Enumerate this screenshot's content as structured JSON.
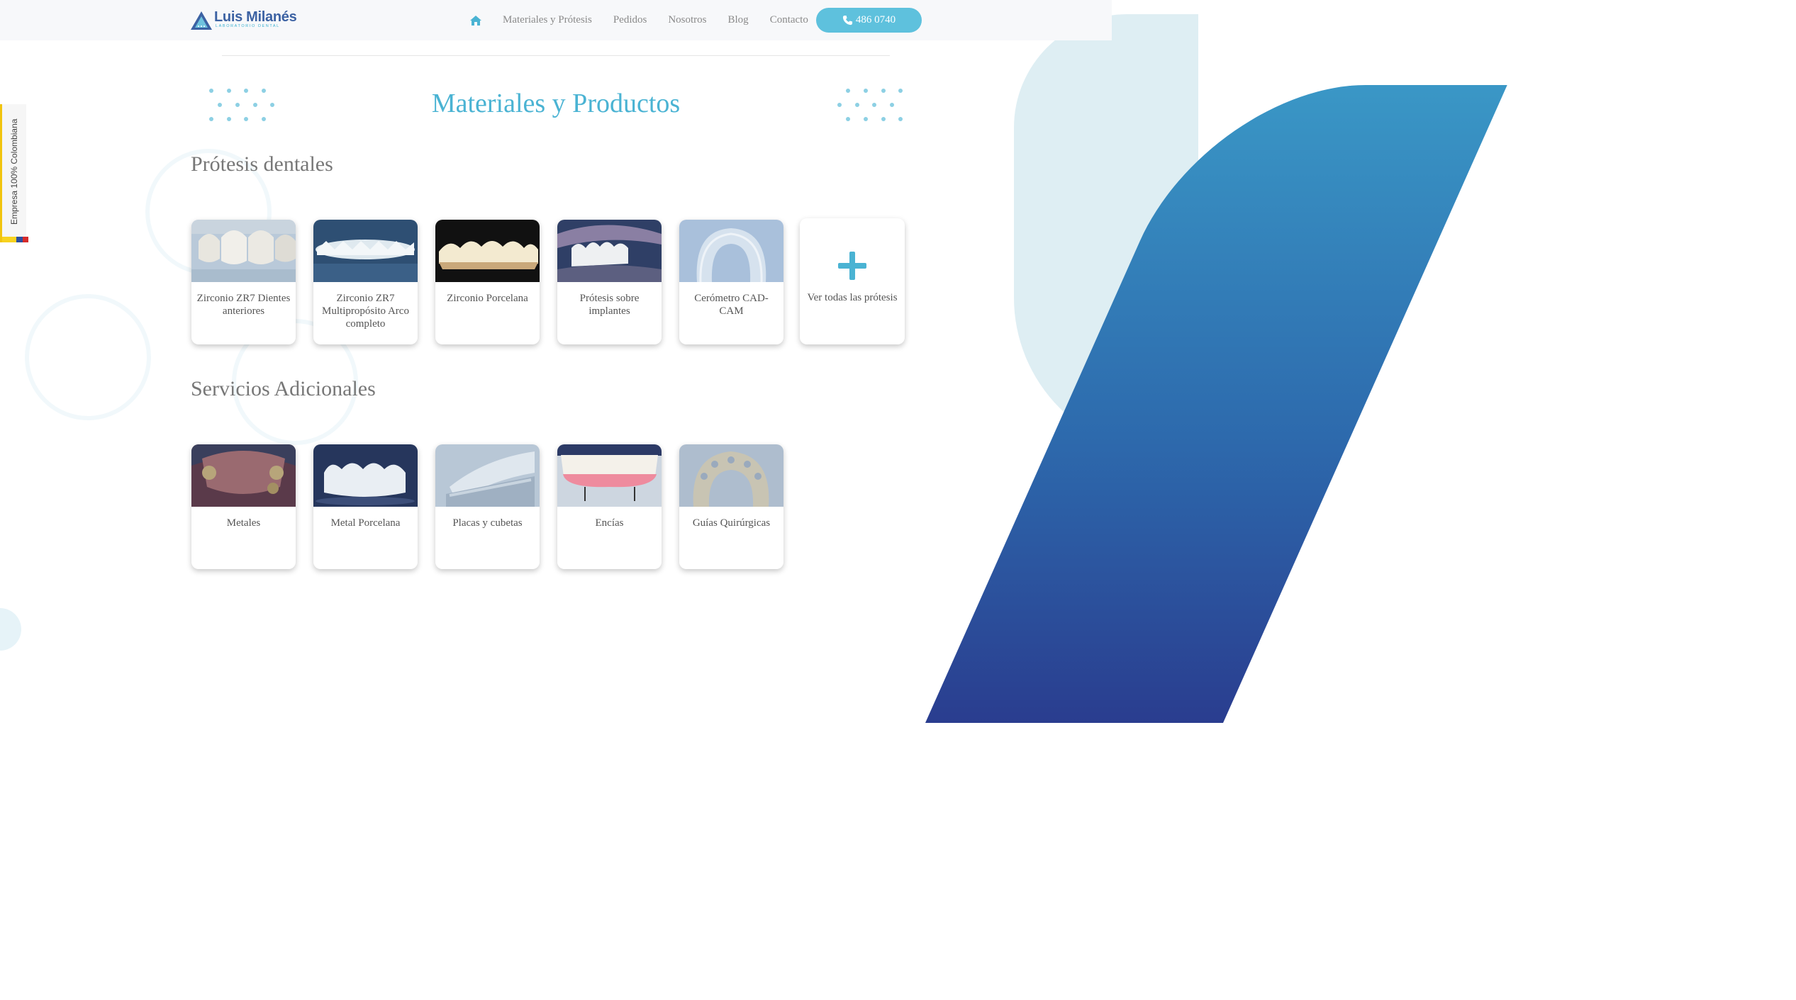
{
  "brand": {
    "name": "Luis Milanés",
    "subtitle": "LABORATORIO DENTAL",
    "primary_color": "#3c62a3",
    "accent_color": "#4ab3d3"
  },
  "nav": {
    "home_icon": "home-icon",
    "items": [
      "Materiales y Prótesis",
      "Pedidos",
      "Nosotros",
      "Blog",
      "Contacto"
    ],
    "phone_icon": "phone-icon",
    "phone": "486 0740"
  },
  "side_tab": {
    "label": "Empresa 100% Colombiana",
    "flag_colors": [
      "#f7d21f",
      "#2b4fa0",
      "#d62b2b"
    ]
  },
  "main": {
    "title": "Materiales y Productos",
    "sections": [
      {
        "title": "Prótesis dentales",
        "cards": [
          "Zirconio ZR7 Dientes anteriores",
          "Zirconio ZR7 Multipropósito Arco completo",
          "Zirconio Porcelana",
          "Prótesis sobre implantes",
          "Cerómetro CAD-CAM"
        ],
        "more_label": "Ver todas las prótesis",
        "more_icon": "plus-icon"
      },
      {
        "title": "Servicios Adicionales",
        "cards": [
          "Metales",
          "Metal Porcelana",
          "Placas y cubetas",
          "Encías",
          "Guías Quirúrgicas"
        ]
      }
    ]
  }
}
